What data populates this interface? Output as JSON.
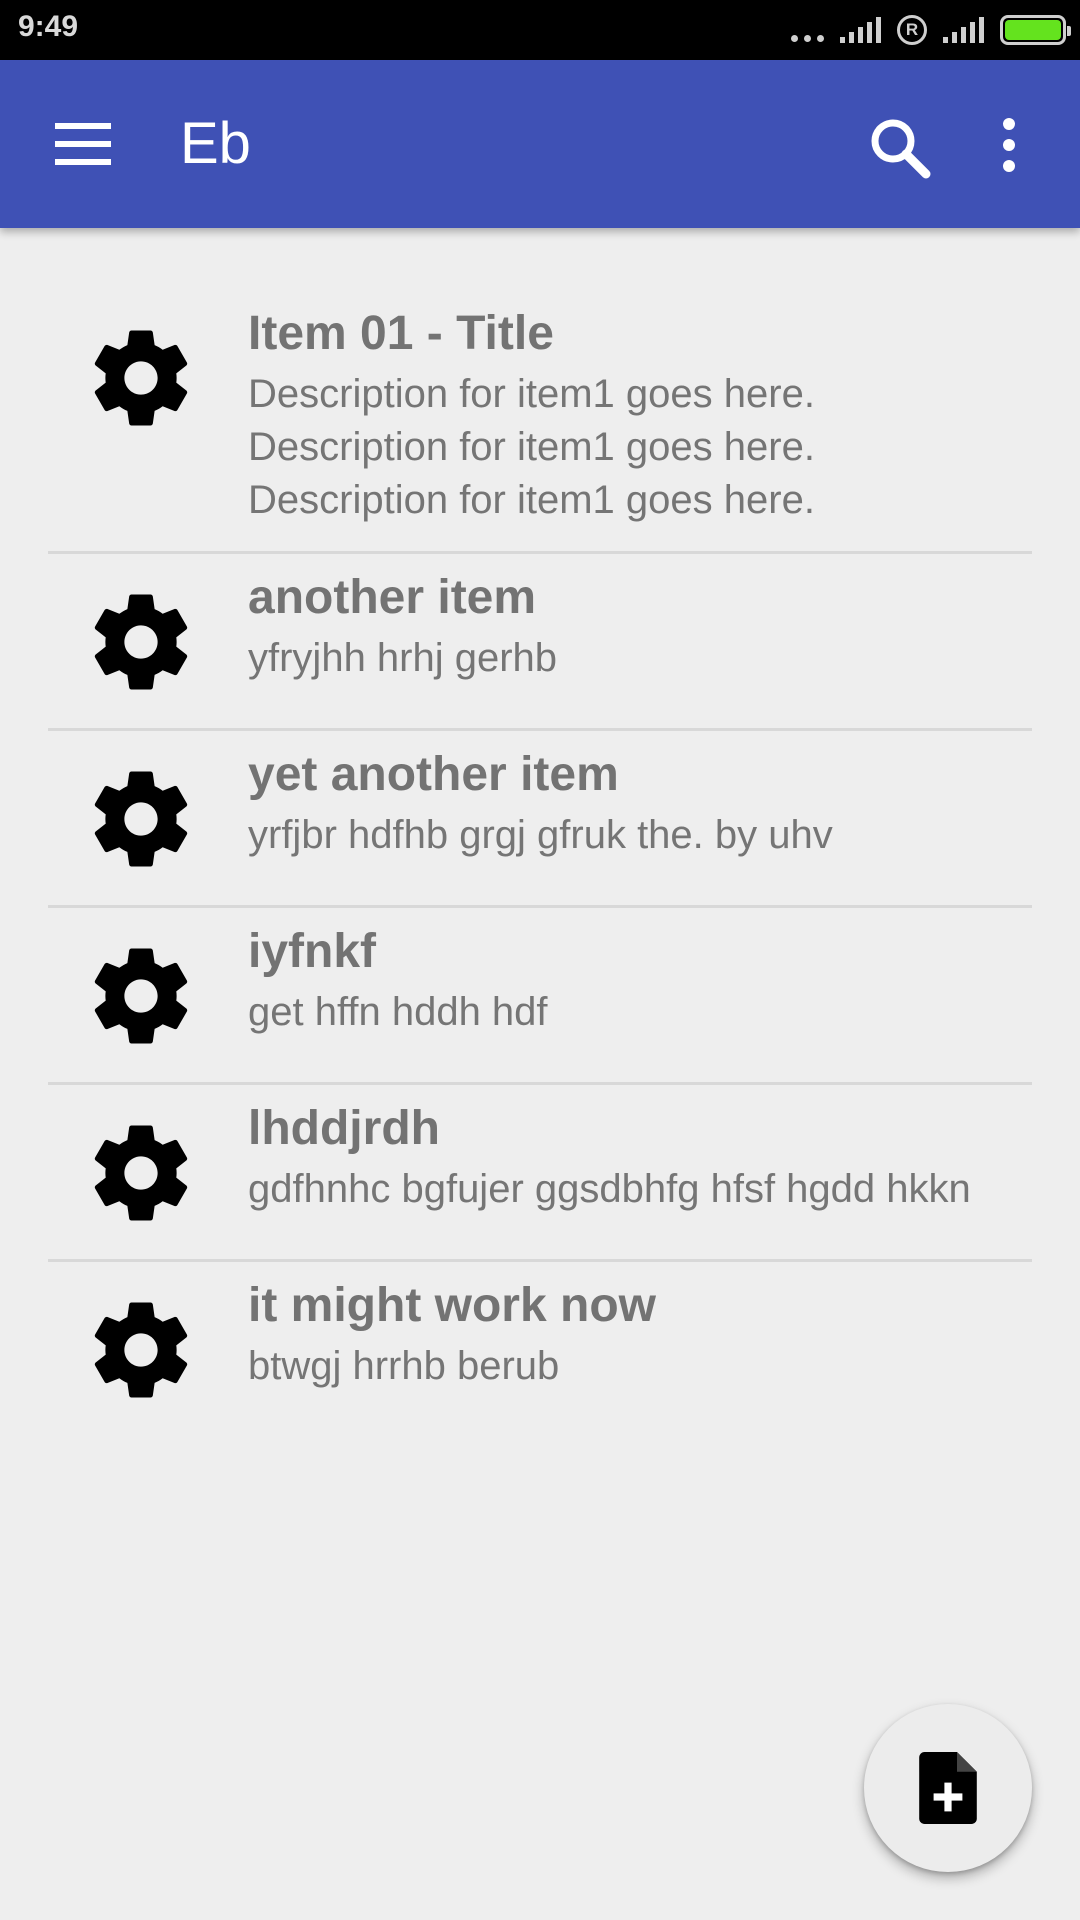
{
  "status_bar": {
    "time": "9:49",
    "roaming_label": "R",
    "icons": [
      "more-dots-icon",
      "signal-icon",
      "roaming-icon",
      "signal-icon",
      "battery-icon"
    ],
    "battery_color": "#64e31e"
  },
  "app_bar": {
    "title": "Eb",
    "color": "#3f51b5",
    "icons": [
      "menu-icon",
      "search-icon",
      "overflow-menu-icon"
    ]
  },
  "items": [
    {
      "title": "Item 01 - Title",
      "description": "Description for item1 goes here. Description for item1 goes here. Description for item1 goes here.",
      "icon": "gear-icon"
    },
    {
      "title": "another item",
      "description": "yfryjhh hrhj gerhb",
      "icon": "gear-icon"
    },
    {
      "title": "yet another item",
      "description": "yrfjbr hdfhb grgj gfruk the. by uhv",
      "icon": "gear-icon"
    },
    {
      "title": "iyfnkf",
      "description": "get hffn hddh hdf",
      "icon": "gear-icon"
    },
    {
      "title": "lhddjrdh",
      "description": "gdfhnhc bgfujer ggsdbhfg hfsf hgdd hkkn",
      "icon": "gear-icon"
    },
    {
      "title": "it might work now",
      "description": "btwgj hrrhb berub",
      "icon": "gear-icon"
    }
  ],
  "fab": {
    "icon": "note-add-icon"
  }
}
